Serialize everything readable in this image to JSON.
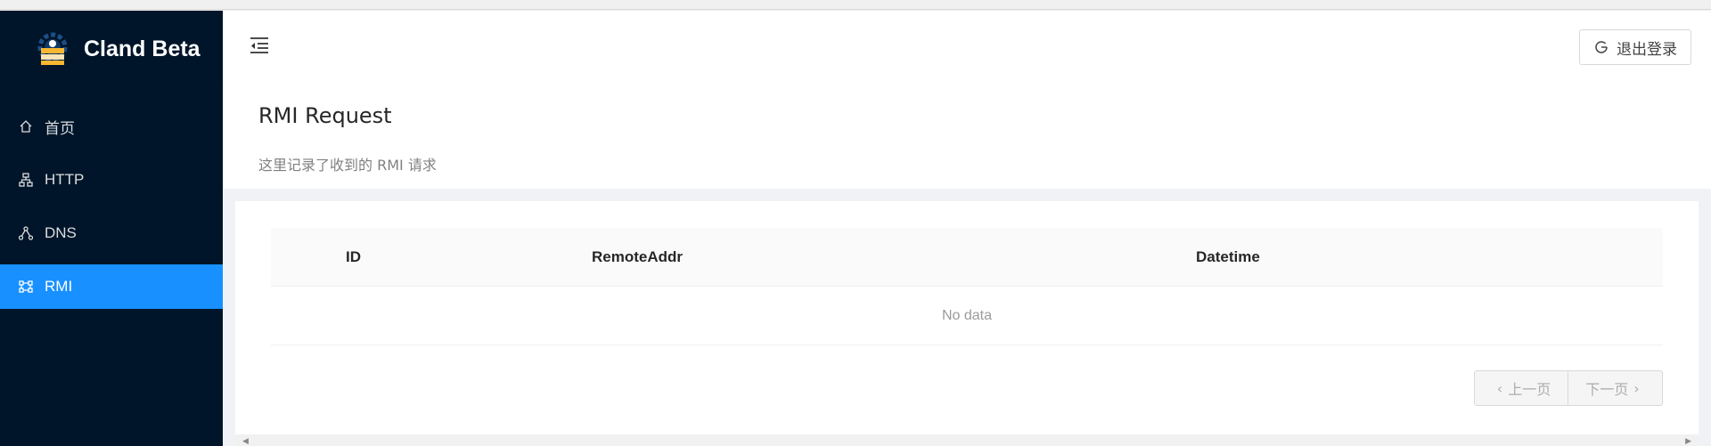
{
  "app": {
    "title": "Cland Beta"
  },
  "sidebar": {
    "items": [
      {
        "label": "首页",
        "icon": "home-icon",
        "active": false
      },
      {
        "label": "HTTP",
        "icon": "sitemap-icon",
        "active": false
      },
      {
        "label": "DNS",
        "icon": "network-icon",
        "active": false
      },
      {
        "label": "RMI",
        "icon": "nodes-icon",
        "active": true
      }
    ]
  },
  "header": {
    "logout_label": "退出登录"
  },
  "page": {
    "title": "RMI Request",
    "subtitle": "这里记录了收到的 RMI 请求"
  },
  "table": {
    "columns": [
      "ID",
      "RemoteAddr",
      "Datetime"
    ],
    "rows": [],
    "empty_text": "No data"
  },
  "pagination": {
    "prev_label": "上一页",
    "next_label": "下一页"
  },
  "colors": {
    "sidebar_bg": "#001529",
    "accent": "#1890ff"
  }
}
